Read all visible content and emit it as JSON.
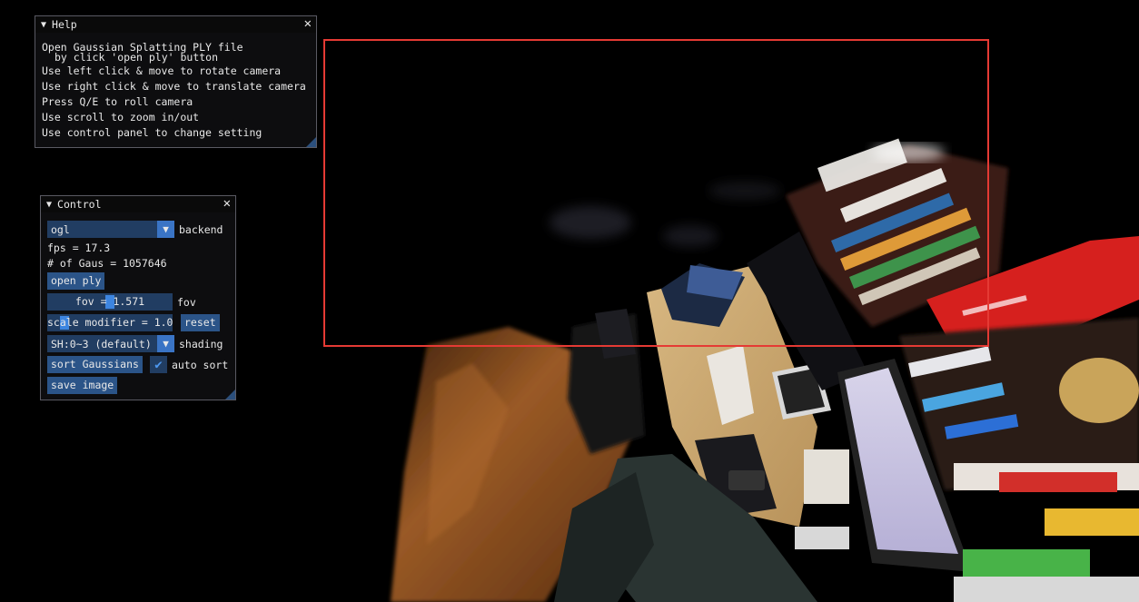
{
  "help": {
    "title": "Help",
    "lines": [
      "Open Gaussian Splatting PLY file",
      "by click 'open ply' button",
      "Use left click & move to rotate camera",
      "Use right click & move to translate camera",
      "Press Q/E to roll camera",
      "Use scroll to zoom in/out",
      "Use control panel to change setting"
    ]
  },
  "control": {
    "title": "Control",
    "backend_value": "ogl",
    "backend_label": "backend",
    "fps": "fps = 17.3",
    "gaus": "# of Gaus = 1057646",
    "open_ply": "open ply",
    "fov_text": "fov = 1.571",
    "fov_label": "fov",
    "fov_level": 0.5,
    "scale_text": "scale modifier = 1.0",
    "scale_level": 0.1,
    "reset": "reset",
    "shading_value": "SH:0~3 (default)",
    "shading_label": "shading",
    "sort": "sort Gaussians",
    "auto_sort": "auto sort",
    "auto_sort_checked": true,
    "save_image": "save image"
  },
  "colors": {
    "accent": "#3d85e0",
    "button": "#2b5488",
    "frame_bg": "#213d62",
    "selection": "#e53a34"
  }
}
